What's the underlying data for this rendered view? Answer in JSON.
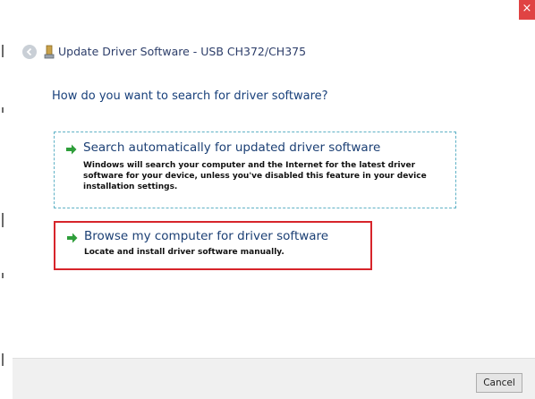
{
  "window": {
    "title": "Update Driver Software - USB CH372/CH375",
    "close_glyph": "×"
  },
  "main": {
    "question": "How do you want to search for driver software?",
    "options": [
      {
        "title": "Search automatically for updated driver software",
        "description": "Windows will search your computer and the Internet for the latest driver software for your device, unless you've disabled this feature in your device installation settings.",
        "icon": "green-arrow-icon"
      },
      {
        "title": "Browse my computer for driver software",
        "description": "Locate and install driver software manually.",
        "icon": "green-arrow-icon"
      }
    ]
  },
  "footer": {
    "cancel_label": "Cancel"
  },
  "colors": {
    "title_text": "#2d3e6a",
    "link_blue": "#1b3f74",
    "highlight_red": "#d7252b",
    "close_red": "#e04343",
    "dashed_focus": "#5fb1c6",
    "arrow_green": "#2e9e3a"
  }
}
